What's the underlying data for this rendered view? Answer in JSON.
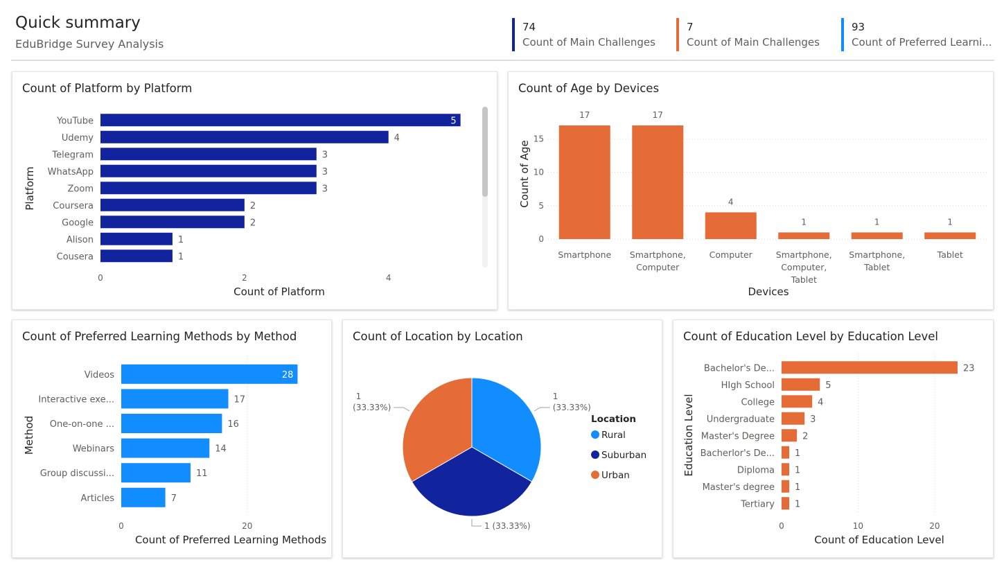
{
  "header": {
    "title": "Quick summary",
    "subtitle": "EduBridge Survey Analysis"
  },
  "kpis": [
    {
      "value": "74",
      "label": "Count of Main Challenges",
      "color": "#12239e"
    },
    {
      "value": "7",
      "label": "Count of Main Challenges",
      "color": "#e66c37"
    },
    {
      "value": "93",
      "label": "Count of Preferred Learni...",
      "color": "#118dff"
    }
  ],
  "colors": {
    "navy": "#12239e",
    "orange": "#e66c37",
    "blue": "#118dff",
    "text": "#252423",
    "muted": "#605e5c"
  },
  "chart_data": [
    {
      "id": "platform",
      "type": "bar",
      "orientation": "horizontal",
      "title": "Count of Platform by Platform",
      "xlabel": "Count of Platform",
      "ylabel": "Platform",
      "categories": [
        "YouTube",
        "Udemy",
        "Telegram",
        "WhatsApp",
        "Zoom",
        "Coursera",
        "Google",
        "Alison",
        "Cousera"
      ],
      "values": [
        5,
        4,
        3,
        3,
        3,
        2,
        2,
        1,
        1
      ],
      "xticks": [
        0,
        2,
        4
      ],
      "xlim": [
        0,
        5.1
      ],
      "color": "#12239e",
      "grid": false
    },
    {
      "id": "devices",
      "type": "bar",
      "orientation": "vertical",
      "title": "Count of Age by Devices",
      "xlabel": "Devices",
      "ylabel": "Count of Age",
      "categories": [
        [
          "Smartphone"
        ],
        [
          "Smartphone,",
          "Computer"
        ],
        [
          "Computer"
        ],
        [
          "Smartphone,",
          "Computer,",
          "Tablet"
        ],
        [
          "Smartphone,",
          "Tablet"
        ],
        [
          "Tablet"
        ]
      ],
      "values": [
        17,
        17,
        4,
        1,
        1,
        1
      ],
      "yticks": [
        0,
        5,
        10,
        15
      ],
      "ylim": [
        0,
        17
      ],
      "color": "#e66c37",
      "grid": true
    },
    {
      "id": "methods",
      "type": "bar",
      "orientation": "horizontal",
      "title": "Count of Preferred Learning Methods by Method",
      "xlabel": "Count of Preferred Learning Methods",
      "ylabel": "Method",
      "categories": [
        "Videos",
        "Interactive exe...",
        "One-on-one ...",
        "Webinars",
        "Group discussi...",
        "Articles"
      ],
      "values": [
        28,
        17,
        16,
        14,
        11,
        7
      ],
      "xticks": [
        0,
        20
      ],
      "xlim": [
        0,
        28.5
      ],
      "color": "#118dff",
      "grid": true
    },
    {
      "id": "location",
      "type": "pie",
      "title": "Count of Location by Location",
      "legend_title": "Location",
      "legend_position": "right",
      "slices": [
        {
          "name": "Rural",
          "value": 1,
          "label": "1 (33.33%)",
          "color": "#118dff"
        },
        {
          "name": "Suburban",
          "value": 1,
          "label": "1 (33.33%)",
          "color": "#12239e"
        },
        {
          "name": "Urban",
          "value": 1,
          "label": "1 (33.33%)",
          "color": "#e66c37"
        }
      ]
    },
    {
      "id": "education",
      "type": "bar",
      "orientation": "horizontal",
      "title": "Count of Education Level by Education Level",
      "xlabel": "Count of Education Level",
      "ylabel": "Education Level",
      "categories": [
        "Bachelor's De...",
        "HIgh School",
        "College",
        "Undergraduate",
        "Master's Degree",
        "Bacherlor's De...",
        "Diploma",
        "Master's degree",
        "Tertiary"
      ],
      "values": [
        23,
        5,
        4,
        3,
        2,
        1,
        1,
        1,
        1
      ],
      "xticks": [
        0,
        10,
        20
      ],
      "xlim": [
        0,
        23
      ],
      "color": "#e66c37",
      "grid": true
    }
  ]
}
